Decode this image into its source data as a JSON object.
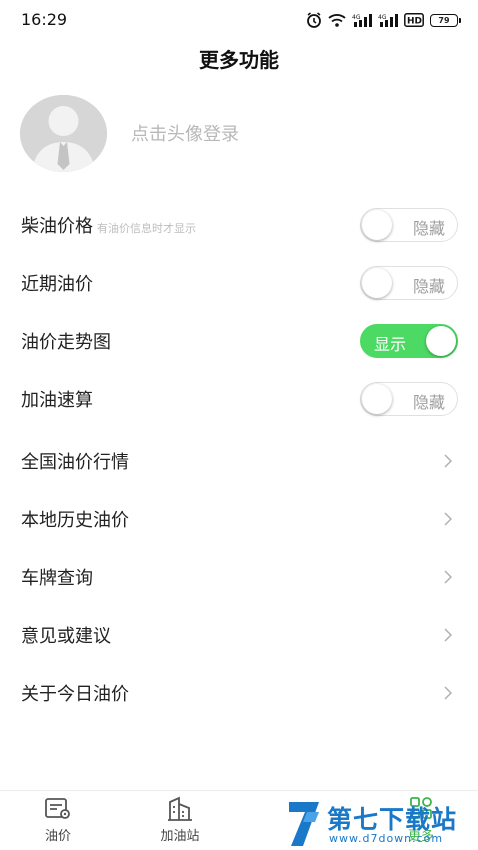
{
  "status": {
    "time": "16:29",
    "battery": "79"
  },
  "header": {
    "title": "更多功能"
  },
  "profile": {
    "login_hint": "点击头像登录"
  },
  "toggle_rows": [
    {
      "label": "柴油价格",
      "note": "有油价信息时才显示",
      "state_label": "隐藏",
      "enabled": false
    },
    {
      "label": "近期油价",
      "state_label": "隐藏",
      "enabled": false
    },
    {
      "label": "油价走势图",
      "state_label": "显示",
      "enabled": true
    },
    {
      "label": "加油速算",
      "state_label": "隐藏",
      "enabled": false
    }
  ],
  "nav_rows": [
    {
      "label": "全国油价行情"
    },
    {
      "label": "本地历史油价"
    },
    {
      "label": "车牌查询"
    },
    {
      "label": "意见或建议"
    },
    {
      "label": "关于今日油价"
    }
  ],
  "tabbar": {
    "tabs": [
      {
        "label": "油价",
        "icon": "price-tag-icon"
      },
      {
        "label": "加油站",
        "icon": "building-icon"
      },
      {
        "label": "更多",
        "icon": "grid-icon",
        "active": true
      }
    ]
  },
  "watermark": {
    "title": "第七下载站",
    "url": "www.d7down.com"
  },
  "colors": {
    "accent": "#4cd964",
    "active_tab": "#3cb44a",
    "watermark": "#1a78c9"
  }
}
